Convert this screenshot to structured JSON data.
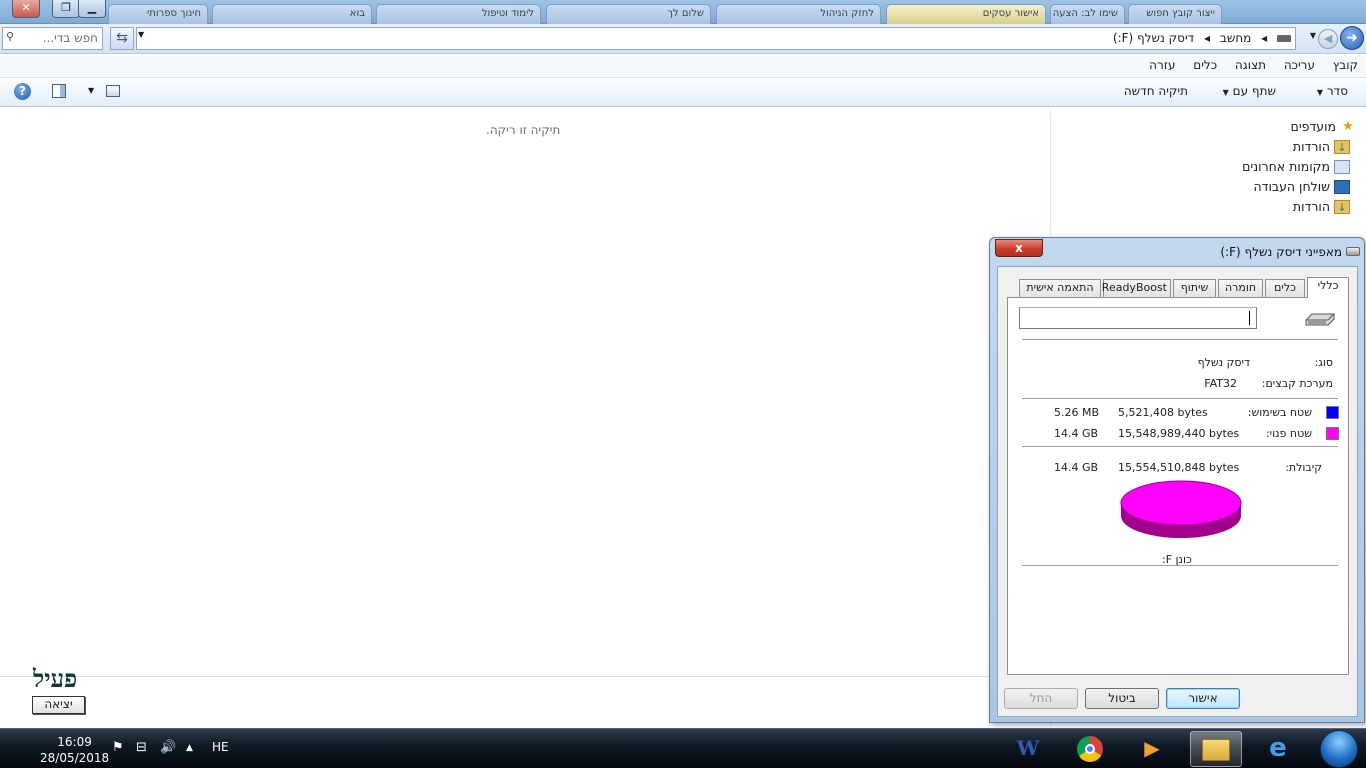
{
  "window_tabs": [
    "ייצור קובץ חפוש",
    "שימו לב: הצעה",
    "אישור עסקים",
    "לחזק הניהול",
    "שלום לך",
    "לימוד וטיפול",
    "בוא",
    "חינוך ספרותי"
  ],
  "address": {
    "path": [
      "מחשב",
      "דיסק נשלף (F:)"
    ],
    "search_placeholder": "חפש בדי..."
  },
  "menu": [
    "קובץ",
    "עריכה",
    "תצוגה",
    "כלים",
    "עזרה"
  ],
  "toolbar": {
    "organize": "סדר",
    "share": "שתף עם",
    "new_folder": "תיקיה חדשה"
  },
  "nav": {
    "favorites": "מועדפים",
    "items": [
      "הורדות",
      "מקומות אחרונים",
      "שולחן העבודה",
      "הורדות"
    ]
  },
  "content": {
    "empty": "תיקיה זו ריקה."
  },
  "overlay": {
    "pail": "פעיל",
    "exit": "יציאה"
  },
  "dialog": {
    "title": "מאפייני דיסק נשלף (F:)",
    "close": "x",
    "tabs": [
      "כללי",
      "כלים",
      "חומרה",
      "שיתוף",
      "ReadyBoost",
      "התאמה אישית"
    ],
    "name_value": "",
    "type_label": "סוג:",
    "type_value": "דיסק נשלף",
    "fs_label": "מערכת קבצים:",
    "fs_value": "FAT32",
    "used_label": "שטח בשימוש:",
    "used_bytes": "5,521,408 bytes",
    "used_size": "5.26 MB",
    "free_label": "שטח פנוי:",
    "free_bytes": "15,548,989,440 bytes",
    "free_size": "14.4 GB",
    "capacity_label": "קיבולת:",
    "capacity_bytes": "15,554,510,848 bytes",
    "capacity_size": "14.4 GB",
    "drive_label": "כונן F:",
    "ok": "אישור",
    "cancel": "ביטול",
    "apply": "החל",
    "used_color": "#0000ff",
    "free_color": "#ff00ff"
  },
  "taskbar": {
    "time": "16:09",
    "date": "28/05/2018",
    "lang": "HE",
    "apps": [
      "word-icon",
      "chrome-icon",
      "media-player-icon",
      "explorer-icon",
      "ie-icon"
    ]
  }
}
